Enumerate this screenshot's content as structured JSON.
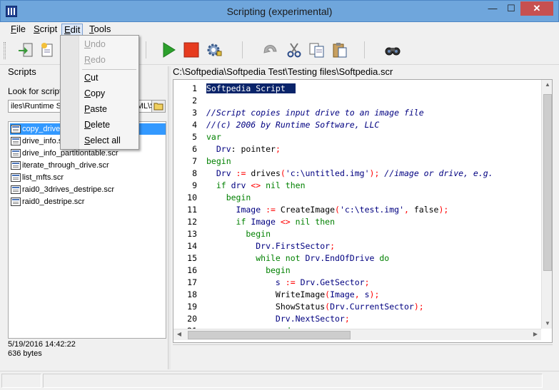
{
  "window": {
    "title": "Scripting (experimental)",
    "minimize_glyph": "—",
    "maximize_glyph": "☐",
    "close_glyph": "✕"
  },
  "menu": {
    "items": [
      {
        "label": "File",
        "underline": "F",
        "rest": "ile"
      },
      {
        "label": "Script",
        "underline": "S",
        "rest": "cript"
      },
      {
        "label": "Edit",
        "underline": "E",
        "rest": "dit"
      },
      {
        "label": "Tools",
        "underline": "T",
        "rest": "ools"
      }
    ]
  },
  "edit_menu": {
    "undo": {
      "u": "U",
      "rest": "ndo"
    },
    "redo": {
      "u": "R",
      "rest": "edo"
    },
    "cut": {
      "u": "C",
      "rest": "ut"
    },
    "copy": {
      "u": "C",
      "rest": "opy"
    },
    "paste": {
      "u": "P",
      "rest": "aste"
    },
    "delete": {
      "u": "D",
      "rest": "elete"
    },
    "select_all": {
      "u": "S",
      "rest": "elect all"
    }
  },
  "toolbar": {
    "icons": [
      "open-icon",
      "new-script-icon",
      "run-icon",
      "stop-icon",
      "settings-gear-icon",
      "undo-icon",
      "cut-icon",
      "copy-icon",
      "paste-icon",
      "find-binoculars-icon"
    ]
  },
  "scripts_panel": {
    "header": "Scripts",
    "look_for_label": "Look for scripts",
    "filter_value": "iles\\Runtime Software\\DriveImage XML\\Scripts Construct",
    "files": [
      "copy_drive.scr",
      "drive_info.scr",
      "drive_info_partitiontable.scr",
      "iterate_through_drive.scr",
      "list_mfts.scr",
      "raid0_3drives_destripe.scr",
      "raid0_destripe.scr"
    ],
    "selected_index": 0,
    "file_date": "5/19/2016 14:42:22",
    "file_size": "636 bytes"
  },
  "editor": {
    "path": "C:\\Softpedia\\Softpedia Test\\Testing files\\Softpedia.scr",
    "line_numbers": [
      "1",
      "2",
      "3",
      "4",
      "5",
      "6",
      "7",
      "8",
      "9",
      "10",
      "11",
      "12",
      "13",
      "14",
      "15",
      "16",
      "17",
      "18",
      "19",
      "20",
      "21"
    ],
    "lines": [
      [
        {
          "t": "Softpedia Script  ",
          "c": "sel"
        }
      ],
      [],
      [
        {
          "t": "//Script copies input drive to an image file",
          "c": "cm"
        }
      ],
      [
        {
          "t": "//(c) 2006 by Runtime Software, LLC",
          "c": "cm"
        }
      ],
      [
        {
          "t": "var",
          "c": "kw"
        }
      ],
      [
        {
          "t": "  Drv",
          "c": "id"
        },
        {
          "t": ": pointer",
          "c": ""
        },
        {
          "t": ";",
          "c": "op"
        }
      ],
      [
        {
          "t": "begin",
          "c": "kw"
        }
      ],
      [
        {
          "t": "  Drv ",
          "c": "id"
        },
        {
          "t": ":=",
          "c": "op"
        },
        {
          "t": " drives",
          "c": ""
        },
        {
          "t": "(",
          "c": "op"
        },
        {
          "t": "'c:\\untitled.img'",
          "c": "str"
        },
        {
          "t": ");",
          "c": "op"
        },
        {
          "t": " //image or drive, e.g. ",
          "c": "cm"
        }
      ],
      [
        {
          "t": "  if",
          "c": "kw"
        },
        {
          "t": " drv ",
          "c": "id"
        },
        {
          "t": "<>",
          "c": "op"
        },
        {
          "t": " nil then",
          "c": "kw"
        }
      ],
      [
        {
          "t": "    begin",
          "c": "kw"
        }
      ],
      [
        {
          "t": "      Image ",
          "c": "id"
        },
        {
          "t": ":=",
          "c": "op"
        },
        {
          "t": " CreateImage",
          "c": ""
        },
        {
          "t": "(",
          "c": "op"
        },
        {
          "t": "'c:\\test.img'",
          "c": "str"
        },
        {
          "t": ",",
          "c": "op"
        },
        {
          "t": " false",
          "c": ""
        },
        {
          "t": ");",
          "c": "op"
        }
      ],
      [
        {
          "t": "      if",
          "c": "kw"
        },
        {
          "t": " Image ",
          "c": "id"
        },
        {
          "t": "<>",
          "c": "op"
        },
        {
          "t": " nil then",
          "c": "kw"
        }
      ],
      [
        {
          "t": "        begin",
          "c": "kw"
        }
      ],
      [
        {
          "t": "          Drv.FirstSector",
          "c": "id"
        },
        {
          "t": ";",
          "c": "op"
        }
      ],
      [
        {
          "t": "          while not",
          "c": "kw"
        },
        {
          "t": " Drv.EndOfDrive ",
          "c": "id"
        },
        {
          "t": "do",
          "c": "kw"
        }
      ],
      [
        {
          "t": "            begin",
          "c": "kw"
        }
      ],
      [
        {
          "t": "              s ",
          "c": "id"
        },
        {
          "t": ":=",
          "c": "op"
        },
        {
          "t": " Drv.GetSector",
          "c": "id"
        },
        {
          "t": ";",
          "c": "op"
        }
      ],
      [
        {
          "t": "              WriteImage",
          "c": ""
        },
        {
          "t": "(",
          "c": "op"
        },
        {
          "t": "Image",
          "c": "id"
        },
        {
          "t": ",",
          "c": "op"
        },
        {
          "t": " s",
          "c": "id"
        },
        {
          "t": ");",
          "c": "op"
        }
      ],
      [
        {
          "t": "              ShowStatus",
          "c": ""
        },
        {
          "t": "(",
          "c": "op"
        },
        {
          "t": "Drv.CurrentSector",
          "c": "id"
        },
        {
          "t": ");",
          "c": "op"
        }
      ],
      [
        {
          "t": "              Drv.NextSector",
          "c": "id"
        },
        {
          "t": ";",
          "c": "op"
        }
      ],
      [
        {
          "t": "              end",
          "c": "kw"
        }
      ]
    ]
  },
  "colors": {
    "keyword": "#008000",
    "comment": "#000080",
    "operator": "#ff0000",
    "selection": "#0a246a",
    "titlebar": "#6fa6dc",
    "list_selected": "#3399ff"
  }
}
